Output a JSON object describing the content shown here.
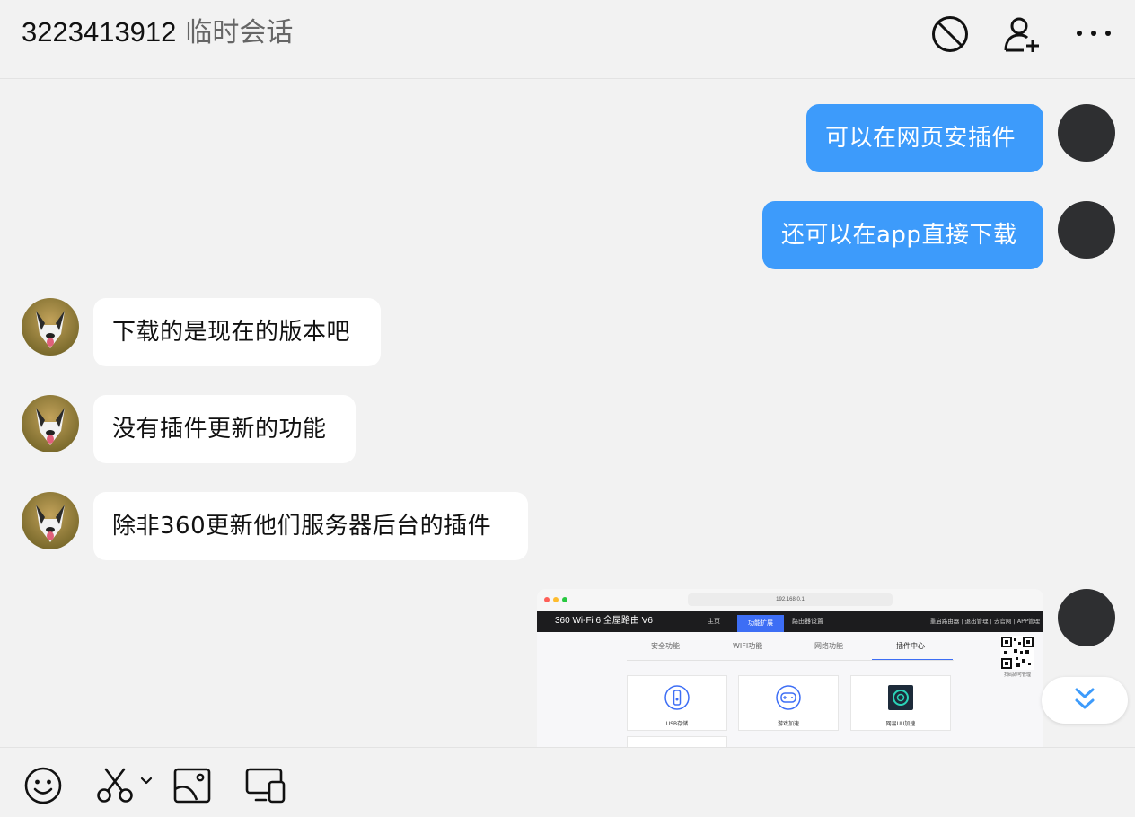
{
  "header": {
    "contact_id": "3223413912",
    "chat_type": "临时会话",
    "icons": [
      "block-icon",
      "add-contact-icon",
      "more-icon"
    ]
  },
  "messages": [
    {
      "side": "out",
      "text": "可以在网页安插件"
    },
    {
      "side": "out",
      "text": "还可以在app直接下载"
    },
    {
      "side": "in",
      "text": "下载的是现在的版本吧"
    },
    {
      "side": "in",
      "text": "没有插件更新的功能"
    },
    {
      "side": "in",
      "text": "除非360更新他们服务器后台的插件"
    }
  ],
  "screenshot": {
    "url": "192.168.0.1",
    "brand": "360 Wi-Fi 6 全屋路由 V6",
    "nav": [
      "主页",
      "功能扩展",
      "路由器设置"
    ],
    "nav_active": "功能扩展",
    "right_links": "重启路由器 | 退出管理 | 去官网 | APP管理",
    "tabs": [
      "安全功能",
      "WIFI功能",
      "网络功能",
      "插件中心"
    ],
    "tab_active": "插件中心",
    "qr_label": "扫码即可管理",
    "cards": [
      {
        "label": "USB存储",
        "icon": "usb-icon"
      },
      {
        "label": "游戏加速",
        "icon": "gamepad-icon"
      },
      {
        "label": "网易UU加速",
        "icon": "uu-accelerator-icon"
      }
    ]
  },
  "toolbar": {
    "icons": [
      "emoji-icon",
      "screenshot-scissors-icon",
      "image-icon",
      "screen-share-icon"
    ]
  },
  "colors": {
    "outgoing_bubble": "#3d9bfb",
    "incoming_bubble": "#ffffff",
    "background": "#f2f2f2",
    "accent": "#3d6ef5"
  }
}
